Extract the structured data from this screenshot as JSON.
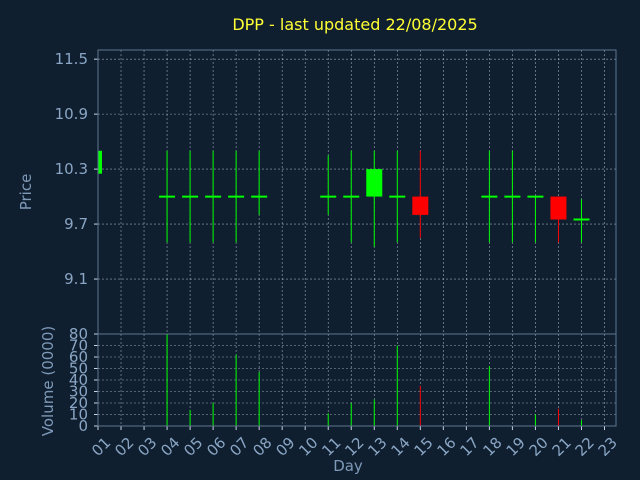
{
  "chart_data": {
    "type": "candlestick",
    "title": "DPP - last updated 22/08/2025",
    "xlabel": "Day",
    "ylabel_price": "Price",
    "ylabel_volume": "Volume (0000)",
    "x_ticks": [
      "01",
      "02",
      "03",
      "04",
      "05",
      "06",
      "07",
      "08",
      "09",
      "10",
      "11",
      "12",
      "13",
      "14",
      "15",
      "16",
      "17",
      "18",
      "19",
      "20",
      "21",
      "22",
      "23"
    ],
    "price_ticks": [
      "11.5",
      "10.9",
      "10.3",
      "9.7",
      "9.1"
    ],
    "price_ylim": [
      8.5,
      11.6
    ],
    "volume_ticks": [
      "80",
      "70",
      "60",
      "50",
      "40",
      "30",
      "20",
      "10",
      "0"
    ],
    "volume_ylim": [
      0,
      80
    ],
    "grid": true,
    "up_color": "#00ff00",
    "down_color": "#ff0000",
    "candles": [
      {
        "day": 1,
        "open": 10.25,
        "high": 10.5,
        "low": 10.25,
        "close": 10.5,
        "volume": 0
      },
      {
        "day": 4,
        "open": 10.0,
        "high": 10.5,
        "low": 9.5,
        "close": 10.0,
        "volume": 80
      },
      {
        "day": 5,
        "open": 10.0,
        "high": 10.5,
        "low": 9.5,
        "close": 10.0,
        "volume": 14
      },
      {
        "day": 6,
        "open": 10.0,
        "high": 10.5,
        "low": 9.5,
        "close": 10.0,
        "volume": 20
      },
      {
        "day": 7,
        "open": 10.0,
        "high": 10.5,
        "low": 9.5,
        "close": 10.0,
        "volume": 62
      },
      {
        "day": 8,
        "open": 10.0,
        "high": 10.5,
        "low": 9.8,
        "close": 10.0,
        "volume": 47
      },
      {
        "day": 11,
        "open": 10.0,
        "high": 10.45,
        "low": 9.8,
        "close": 10.0,
        "volume": 11
      },
      {
        "day": 12,
        "open": 10.0,
        "high": 10.5,
        "low": 9.5,
        "close": 10.0,
        "volume": 20
      },
      {
        "day": 13,
        "open": 10.0,
        "high": 10.5,
        "low": 9.45,
        "close": 10.3,
        "volume": 23
      },
      {
        "day": 14,
        "open": 10.0,
        "high": 10.5,
        "low": 9.5,
        "close": 10.0,
        "volume": 70
      },
      {
        "day": 15,
        "open": 10.0,
        "high": 10.5,
        "low": 9.55,
        "close": 9.8,
        "volume": 35
      },
      {
        "day": 18,
        "open": 10.0,
        "high": 10.5,
        "low": 9.5,
        "close": 10.0,
        "volume": 52
      },
      {
        "day": 19,
        "open": 10.0,
        "high": 10.5,
        "low": 9.5,
        "close": 10.0,
        "volume": 0
      },
      {
        "day": 20,
        "open": 10.0,
        "high": 10.0,
        "low": 9.5,
        "close": 10.0,
        "volume": 10
      },
      {
        "day": 21,
        "open": 10.0,
        "high": 10.0,
        "low": 9.5,
        "close": 9.75,
        "volume": 15
      },
      {
        "day": 22,
        "open": 9.75,
        "high": 9.97,
        "low": 9.5,
        "close": 9.75,
        "volume": 5
      }
    ]
  }
}
